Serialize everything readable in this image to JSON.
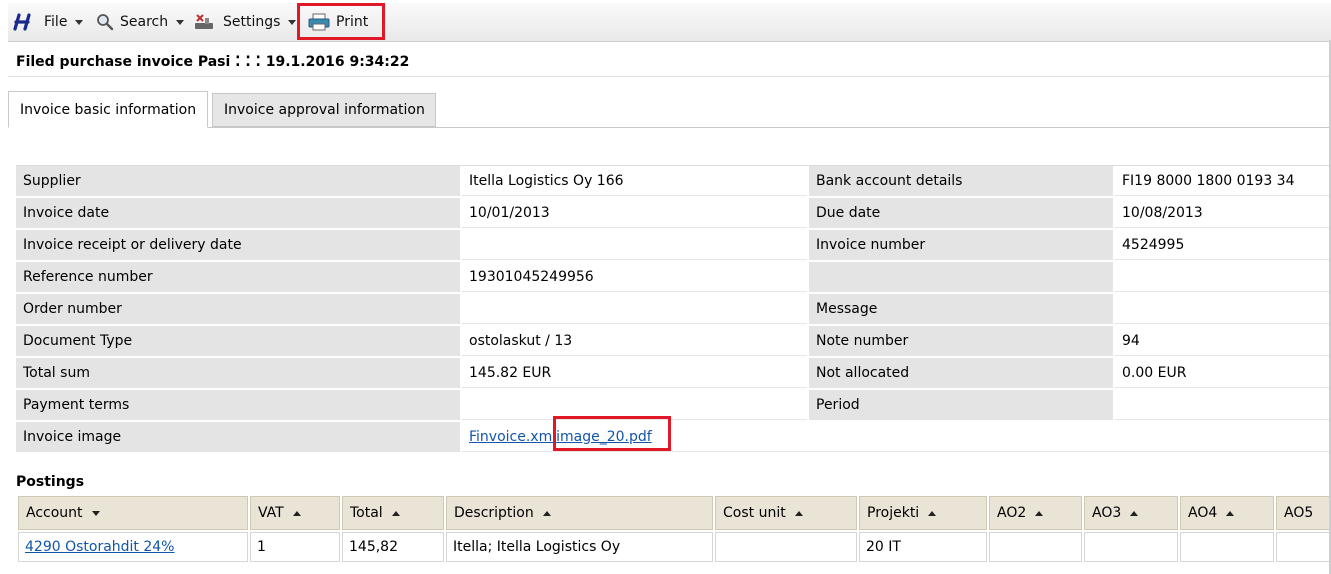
{
  "toolbar": {
    "file_label": "File",
    "search_label": "Search",
    "settings_label": "Settings",
    "print_label": "Print"
  },
  "page": {
    "title": "Filed purchase invoice Pasi ⁚ ⁚ ⁚ 19.1.2016 9:34:22"
  },
  "tabs": [
    {
      "label": "Invoice basic information",
      "active": true
    },
    {
      "label": "Invoice approval information",
      "active": false
    }
  ],
  "info_rows": [
    {
      "l1": "Supplier",
      "v1": "Itella Logistics Oy  166",
      "l2": "Bank account details",
      "v2": "FI19 8000 1800 0193 34"
    },
    {
      "l1": "Invoice date",
      "v1": "10/01/2013",
      "l2": "Due date",
      "v2": "10/08/2013"
    },
    {
      "l1": "Invoice receipt or delivery date",
      "v1": "",
      "l2": "Invoice number",
      "v2": "4524995"
    },
    {
      "l1": "Reference number",
      "v1": "19301045249956",
      "l2": "",
      "v2": ""
    },
    {
      "l1": "Order number",
      "v1": "",
      "l2": "Message",
      "v2": ""
    },
    {
      "l1": "Document Type",
      "v1": "ostolaskut / 13",
      "l2": "Note number",
      "v2": "94"
    },
    {
      "l1": "Total sum",
      "v1": "145.82 EUR",
      "l2": "Not allocated",
      "v2": "0.00 EUR"
    },
    {
      "l1": "Payment terms",
      "v1": "",
      "l2": "Period",
      "v2": ""
    }
  ],
  "invoice_image": {
    "label": "Invoice image",
    "link1": "Finvoice.xml",
    "link2": "image_20.pdf"
  },
  "postings": {
    "title": "Postings",
    "columns": [
      "Account",
      "VAT",
      "Total",
      "Description",
      "Cost unit",
      "Projekti",
      "AO2",
      "AO3",
      "AO4",
      "AO5"
    ],
    "rows": [
      {
        "account": "4290 Ostorahdit 24%",
        "vat": "1",
        "total": "145,82",
        "description": "Itella; Itella Logistics Oy",
        "cost_unit": "",
        "projekti": "20 IT",
        "ao2": "",
        "ao3": "",
        "ao4": "",
        "ao5": ""
      }
    ]
  },
  "colors": {
    "highlight": "#e01828",
    "link": "#1155aa",
    "header_bg": "#e9e4d6",
    "label_bg": "#e4e4e4"
  }
}
